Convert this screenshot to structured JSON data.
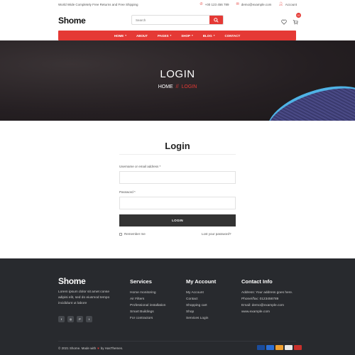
{
  "topbar": {
    "notice": "World Wide Completely Free Returns and Free Shipping",
    "phone": "+00 123 456 789",
    "email": "demo@example.com",
    "account": "Account"
  },
  "header": {
    "logo": "Shome",
    "search_placeholder": "Search",
    "cart_count": "02"
  },
  "nav": {
    "items": [
      {
        "label": "HOME",
        "caret": "▾"
      },
      {
        "label": "ABOUT",
        "caret": ""
      },
      {
        "label": "PAGES",
        "caret": "▾"
      },
      {
        "label": "SHOP",
        "caret": "▾"
      },
      {
        "label": "BLOG",
        "caret": "▾"
      },
      {
        "label": "CONTACT",
        "caret": ""
      }
    ]
  },
  "banner": {
    "title": "LOGIN",
    "crumb_home": "HOME",
    "crumb_sep": "//",
    "crumb_current": "LOGIN"
  },
  "form": {
    "title": "Login",
    "username_label": "Username or email address *",
    "password_label": "Password *",
    "button": "LOGIN",
    "remember": "Remember me",
    "lost": "Lost your password?"
  },
  "footer": {
    "logo": "Shome",
    "description": "Lorem ipsum dolor sit amet conse adipisi elit, sed do eiusmod tempo incididunt ut labore",
    "socials": [
      "f",
      "◎",
      "P",
      "t"
    ],
    "services": {
      "title": "Services",
      "items": [
        "Home monitoring",
        "Air Filters",
        "Professional installation",
        "Smart Buildings",
        "For contractors"
      ]
    },
    "account": {
      "title": "My Account",
      "items": [
        "My Account",
        "Contact",
        "Shopping cart",
        "Shop",
        "Services Login"
      ]
    },
    "contact": {
      "title": "Contact Info",
      "items": [
        "Address: Your address goes here.",
        "Phone//fax: 0123456789",
        "Email: demo@example.com",
        "www.example.com"
      ]
    },
    "copyright_pre": "© 2021 Shome. Made with",
    "copyright_post": "by HasThemes.",
    "payment_colors": [
      "#1a4c9c",
      "#2b6fd6",
      "#f0a030",
      "#e8e8e8",
      "#c9302c"
    ]
  }
}
